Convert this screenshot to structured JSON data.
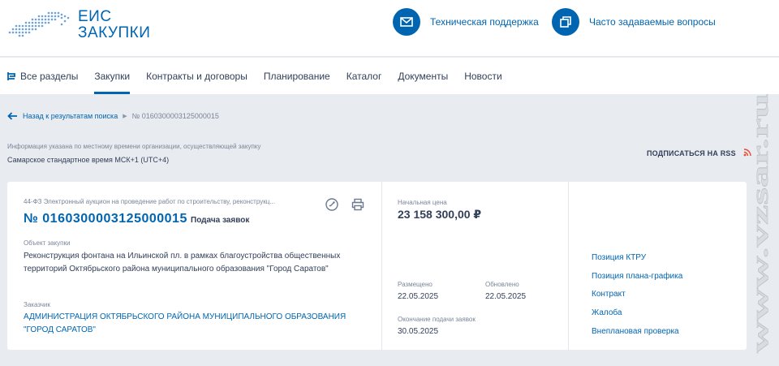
{
  "logo": {
    "line1": "ЕИС",
    "line2": "ЗАКУПКИ"
  },
  "header": {
    "support": {
      "label": "Техническая поддержка",
      "icon": "mail-icon"
    },
    "faq": {
      "label": "Часто задаваемые вопросы",
      "icon": "faq-icon"
    }
  },
  "nav": {
    "items": [
      {
        "label": "Все разделы",
        "active": false
      },
      {
        "label": "Закупки",
        "active": true
      },
      {
        "label": "Контракты и договоры",
        "active": false
      },
      {
        "label": "Планирование",
        "active": false
      },
      {
        "label": "Каталог",
        "active": false
      },
      {
        "label": "Документы",
        "active": false
      },
      {
        "label": "Новости",
        "active": false
      }
    ]
  },
  "breadcrumb": {
    "back": "Назад к результатам поиска",
    "current": "№ 0160300003125000015"
  },
  "info": {
    "note": "Информация указана по местному времени организации, осуществляющей закупку",
    "timezone": "Самарское стандартное время МСК+1 (UTC+4)",
    "rss": "ПОДПИСАТЬСЯ НА RSS"
  },
  "purchase": {
    "type": "44-ФЗ Электронный аукцион на проведение работ по строительству, реконструкц...",
    "number": "№ 0160300003125000015",
    "status": "Подача заявок",
    "object_label": "Объект закупки",
    "object": "Реконструкция фонтана на Ильинской пл. в рамках благоустройства общественных территорий Октябрьского района муниципального образования \"Город Саратов\"",
    "customer_label": "Заказчик",
    "customer": "АДМИНИСТРАЦИЯ ОКТЯБРЬСКОГО РАЙОНА МУНИЦИПАЛЬНОГО ОБРАЗОВАНИЯ \"ГОРОД САРАТОВ\""
  },
  "price": {
    "label": "Начальная цена",
    "value": "23 158 300,00 ₽"
  },
  "dates": {
    "placed_label": "Размещено",
    "placed": "22.05.2025",
    "updated_label": "Обновлено",
    "updated": "22.05.2025",
    "end_label": "Окончание подачи заявок",
    "end": "30.05.2025"
  },
  "links": [
    "Позиция КТРУ",
    "Позиция плана-графика",
    "Контракт",
    "Жалоба",
    "Внеплановая проверка"
  ],
  "watermark": "www.vzsar.ru",
  "colors": {
    "accent": "#0065b1",
    "text": "#334059",
    "muted": "#7a8699",
    "rss": "#e8492f"
  }
}
